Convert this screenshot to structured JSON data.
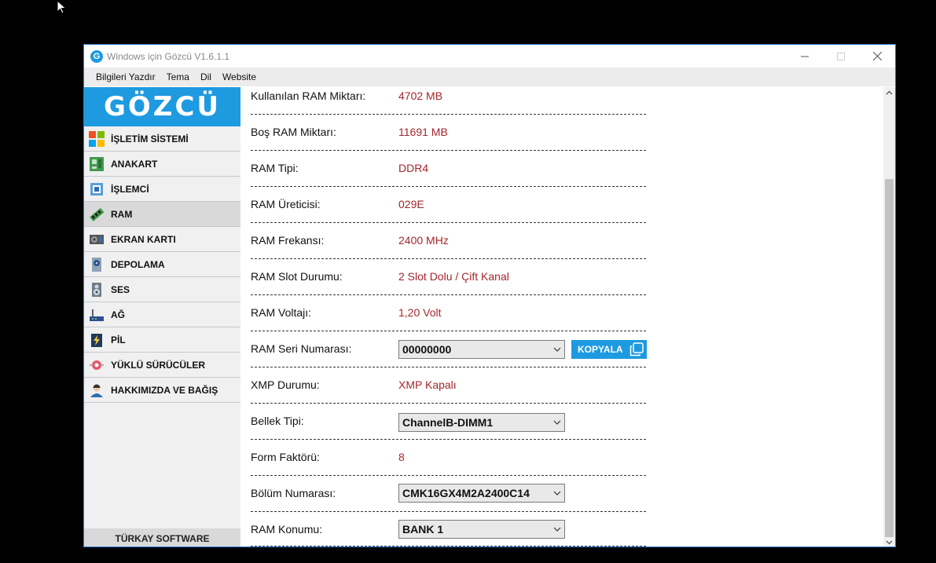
{
  "window": {
    "title": "Windows için Gözcü V1.6.1.1",
    "app_icon_letter": "G"
  },
  "menu": [
    "Bilgileri Yazdır",
    "Tema",
    "Dil",
    "Website"
  ],
  "sidebar": {
    "logo": "GÖZCÜ",
    "items": [
      {
        "label": "İŞLETİM SİSTEMİ",
        "icon": "windows-logo-icon"
      },
      {
        "label": "ANAKART",
        "icon": "motherboard-icon"
      },
      {
        "label": "İŞLEMCİ",
        "icon": "cpu-icon"
      },
      {
        "label": "RAM",
        "icon": "ram-module-icon",
        "active": true
      },
      {
        "label": "EKRAN KARTI",
        "icon": "graphics-card-icon"
      },
      {
        "label": "DEPOLAMA",
        "icon": "storage-drive-icon"
      },
      {
        "label": "SES",
        "icon": "speaker-icon"
      },
      {
        "label": "AĞ",
        "icon": "router-icon"
      },
      {
        "label": "PİL",
        "icon": "battery-icon"
      },
      {
        "label": "YÜKLÜ SÜRÜCÜLER",
        "icon": "drivers-icon"
      },
      {
        "label": "HAKKIMIZDA VE BAĞIŞ",
        "icon": "user-icon"
      }
    ],
    "footer": "TÜRKAY SOFTWARE"
  },
  "ram": {
    "rows": [
      {
        "label": "Kullanılan RAM Miktarı:",
        "value": "4702 MB"
      },
      {
        "label": "Boş RAM Miktarı:",
        "value": "11691 MB"
      },
      {
        "label": "RAM Tipi:",
        "value": "DDR4"
      },
      {
        "label": "RAM Üreticisi:",
        "value": "029E"
      },
      {
        "label": "RAM Frekansı:",
        "value": "2400 MHz"
      },
      {
        "label": "RAM Slot Durumu:",
        "value": "2 Slot Dolu / Çift Kanal"
      },
      {
        "label": "RAM Voltajı:",
        "value": "1,20 Volt"
      },
      {
        "label": "RAM Seri Numarası:",
        "select": "00000000"
      },
      {
        "label": "XMP Durumu:",
        "value": "XMP Kapalı"
      },
      {
        "label": "Bellek Tipi:",
        "select": "ChannelB-DIMM1"
      },
      {
        "label": "Form Faktörü:",
        "value": "8"
      },
      {
        "label": "Bölüm Numarası:",
        "select": "CMK16GX4M2A2400C14"
      },
      {
        "label": "RAM Konumu:",
        "select": "BANK 1"
      }
    ],
    "copy_button": "KOPYALA",
    "separator": "-------------------------------------------------------------------------------------------------"
  },
  "colors": {
    "accent": "#1e9ae0",
    "value_text": "#a4262c",
    "sidebar_bg": "#f0f0f0",
    "active_item_bg": "#d9d9d9"
  }
}
